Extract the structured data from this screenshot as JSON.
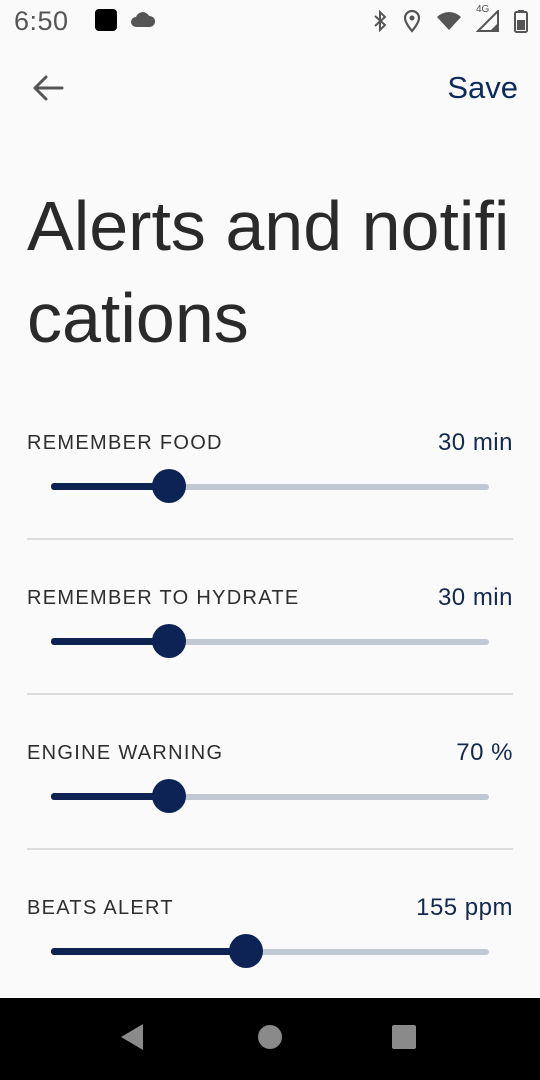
{
  "status_bar": {
    "time": "6:50",
    "network_label": "4G",
    "icons": [
      "app-square-icon",
      "cloud-icon",
      "bluetooth-icon",
      "location-icon",
      "wifi-icon",
      "signal-icon",
      "battery-icon"
    ]
  },
  "app_bar": {
    "back_icon": "arrow-left-icon",
    "save_label": "Save"
  },
  "page": {
    "title": "Alerts and notifications"
  },
  "settings": [
    {
      "label": "REMEMBER FOOD",
      "value": "30 min",
      "slider_fraction": 0.27
    },
    {
      "label": "REMEMBER TO HYDRATE",
      "value": "30 min",
      "slider_fraction": 0.27
    },
    {
      "label": "ENGINE WARNING",
      "value": "70 %",
      "slider_fraction": 0.27
    },
    {
      "label": "BEATS ALERT",
      "value": "155 ppm",
      "slider_fraction": 0.446
    }
  ],
  "colors": {
    "accent": "#0d2356",
    "track": "#c1c8d4",
    "background": "#fafafa",
    "nav_bar": "#000000"
  },
  "nav_bar": {
    "buttons": [
      "back-triangle-icon",
      "home-circle-icon",
      "recents-square-icon"
    ]
  }
}
